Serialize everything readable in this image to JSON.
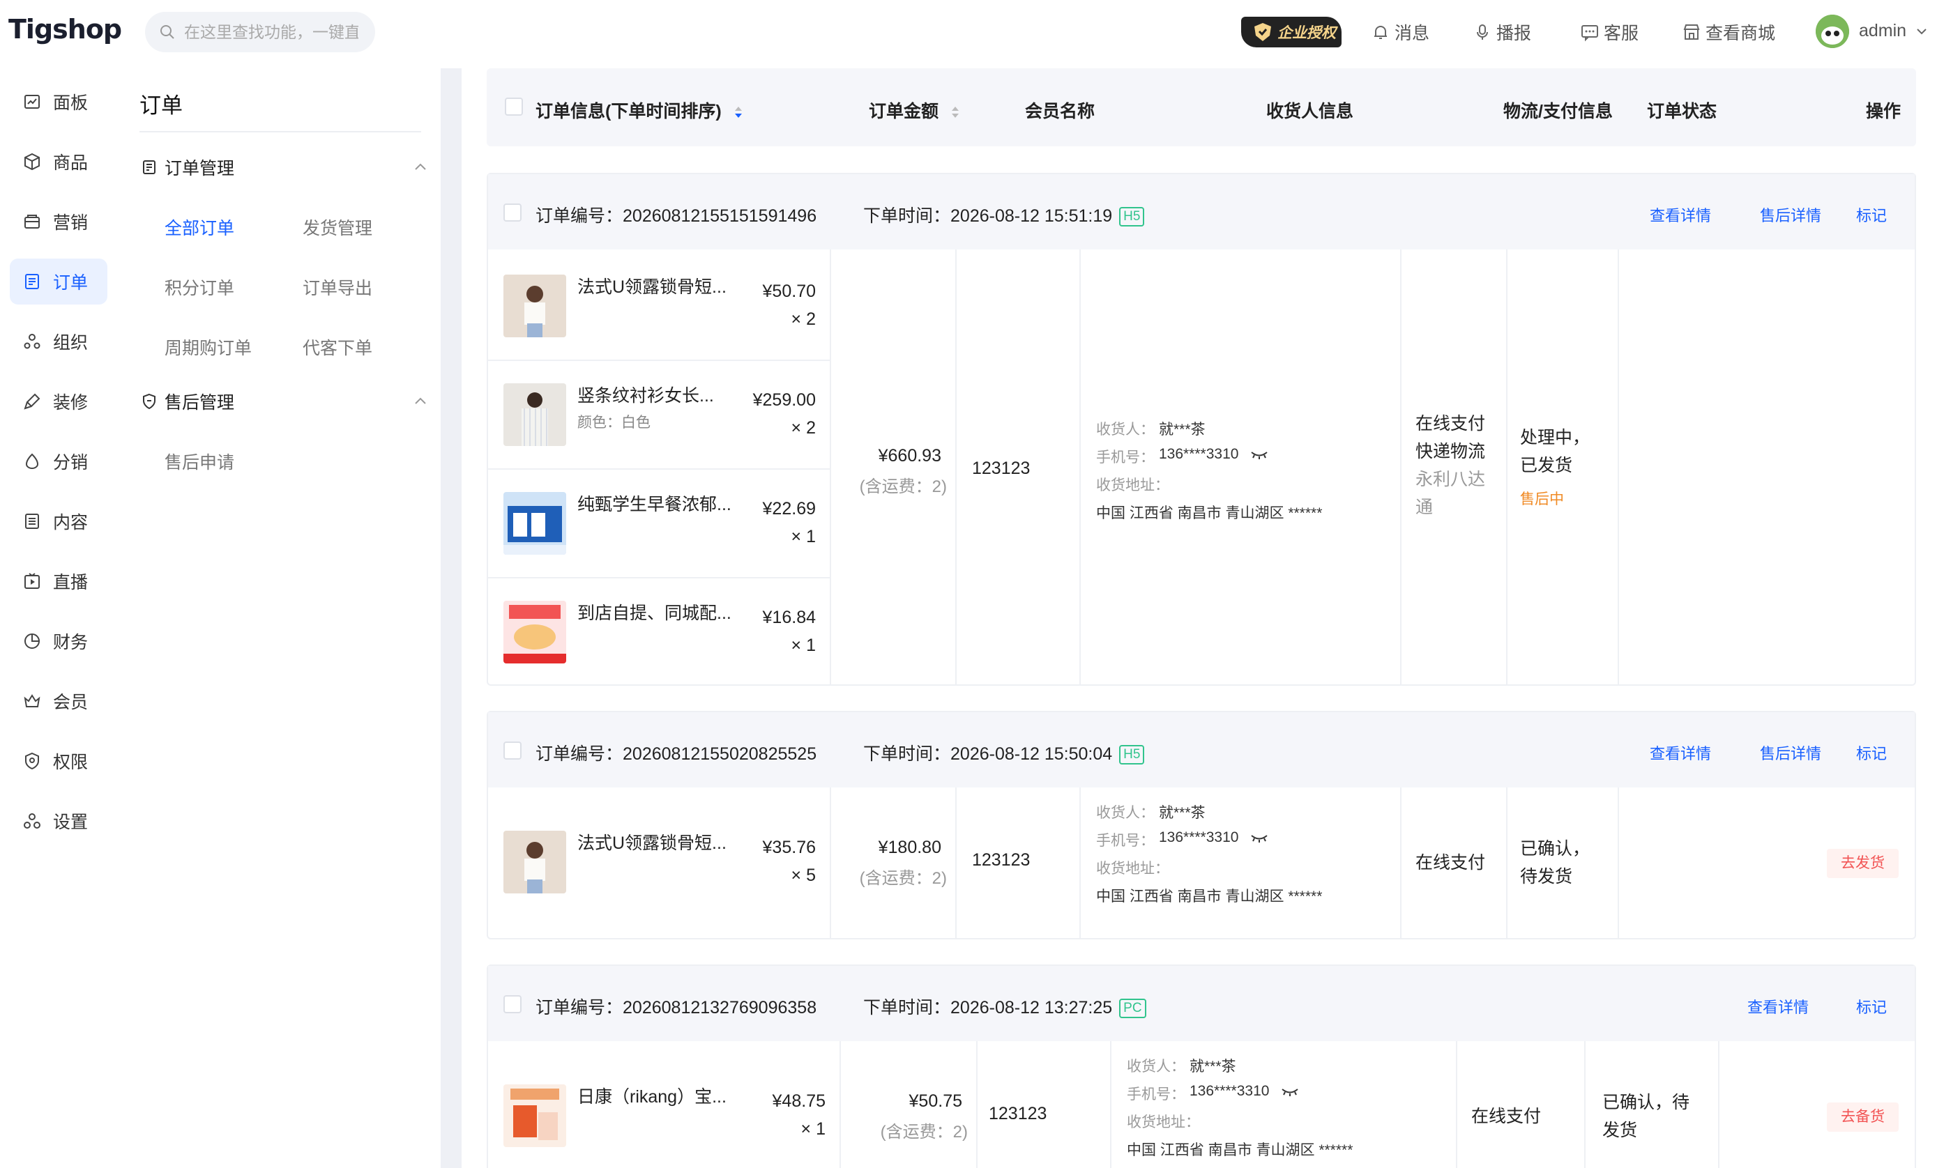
{
  "brand": {
    "logo": "Tigshop"
  },
  "search": {
    "placeholder": "在这里查找功能，一键直达"
  },
  "topbar": {
    "auth_badge": "企业授权",
    "items": [
      {
        "label": "消息",
        "icon": "bell-icon"
      },
      {
        "label": "播报",
        "icon": "microphone-icon"
      },
      {
        "label": "客服",
        "icon": "chat-icon"
      },
      {
        "label": "查看商城",
        "icon": "store-icon"
      }
    ],
    "user": "admin"
  },
  "rail": {
    "items": [
      {
        "label": "面板",
        "icon": "dashboard-icon"
      },
      {
        "label": "商品",
        "icon": "box-icon"
      },
      {
        "label": "营销",
        "icon": "marketing-icon"
      },
      {
        "label": "订单",
        "icon": "order-icon",
        "active": true
      },
      {
        "label": "组织",
        "icon": "org-icon"
      },
      {
        "label": "装修",
        "icon": "brush-icon"
      },
      {
        "label": "分销",
        "icon": "distribution-icon"
      },
      {
        "label": "内容",
        "icon": "content-icon"
      },
      {
        "label": "直播",
        "icon": "live-icon"
      },
      {
        "label": "财务",
        "icon": "finance-icon"
      },
      {
        "label": "会员",
        "icon": "member-icon"
      },
      {
        "label": "权限",
        "icon": "permission-icon"
      },
      {
        "label": "设置",
        "icon": "settings-icon"
      }
    ]
  },
  "subside": {
    "title": "订单",
    "groups": [
      {
        "label": "订单管理",
        "links": [
          "全部订单",
          "发货管理",
          "积分订单",
          "订单导出",
          "周期购订单",
          "代客下单"
        ]
      },
      {
        "label": "售后管理",
        "links": [
          "售后申请"
        ]
      }
    ],
    "active_link": "全部订单"
  },
  "table": {
    "headers": {
      "info": "订单信息(下单时间排序)",
      "amount": "订单金额",
      "member": "会员名称",
      "receiver": "收货人信息",
      "logistics": "物流/支付信息",
      "status": "订单状态",
      "ops": "操作"
    }
  },
  "labels": {
    "order_no": "订单编号：",
    "order_time": "下单时间：",
    "receiver": "收货人：",
    "phone": "手机号：",
    "address": "收货地址：",
    "view_detail": "查看详情",
    "aftersale_detail": "售后详情",
    "mark": "标记"
  },
  "orders": [
    {
      "order_no": "20260812155151591496",
      "time": "2026-08-12 15:51:19",
      "channel": "H5",
      "items": [
        {
          "name": "法式U领露锁骨短...",
          "spec": "",
          "price": "¥50.70",
          "qty": "× 2"
        },
        {
          "name": "竖条纹衬衫女长...",
          "spec": "颜色：白色",
          "price": "¥259.00",
          "qty": "× 2"
        },
        {
          "name": "纯甄学生早餐浓郁...",
          "spec": "",
          "price": "¥22.69",
          "qty": "× 1"
        },
        {
          "name": "到店自提、同城配...",
          "spec": "",
          "price": "¥16.84",
          "qty": "× 1"
        }
      ],
      "amount": "¥660.93",
      "shipping": "(含运费：2)",
      "member": "123123",
      "receiver_name": "就***茶",
      "phone": "136****3310",
      "address": "中国 江西省 南昌市 青山湖区 ******",
      "pay": "在线支付",
      "logistics": "快递物流",
      "carrier": "永利八达通",
      "status": "处理中，已发货",
      "status_extra": "售后中"
    },
    {
      "order_no": "20260812155020825525",
      "time": "2026-08-12 15:50:04",
      "channel": "H5",
      "items": [
        {
          "name": "法式U领露锁骨短...",
          "spec": "",
          "price": "¥35.76",
          "qty": "× 5"
        }
      ],
      "amount": "¥180.80",
      "shipping": "(含运费：2)",
      "member": "123123",
      "receiver_name": "就***茶",
      "phone": "136****3310",
      "address": "中国 江西省 南昌市 青山湖区 ******",
      "pay": "在线支付",
      "status": "已确认，待发货",
      "action": "去发货"
    },
    {
      "order_no": "20260812132769096358",
      "time": "2026-08-12 13:27:25",
      "channel": "PC",
      "items": [
        {
          "name": "日康（rikang）宝...",
          "spec": "",
          "price": "¥48.75",
          "qty": "× 1"
        }
      ],
      "amount": "¥50.75",
      "shipping": "(含运费：2)",
      "member": "123123",
      "receiver_name": "就***茶",
      "phone": "136****3310",
      "address": "中国 江西省 南昌市 青山湖区 ******",
      "pay": "在线支付",
      "status": "已确认，待发货",
      "action": "去备货"
    }
  ],
  "colors": {
    "accent": "#1960ff",
    "danger": "#f25454",
    "warn": "#f08a24",
    "tag": "#31c48d"
  }
}
